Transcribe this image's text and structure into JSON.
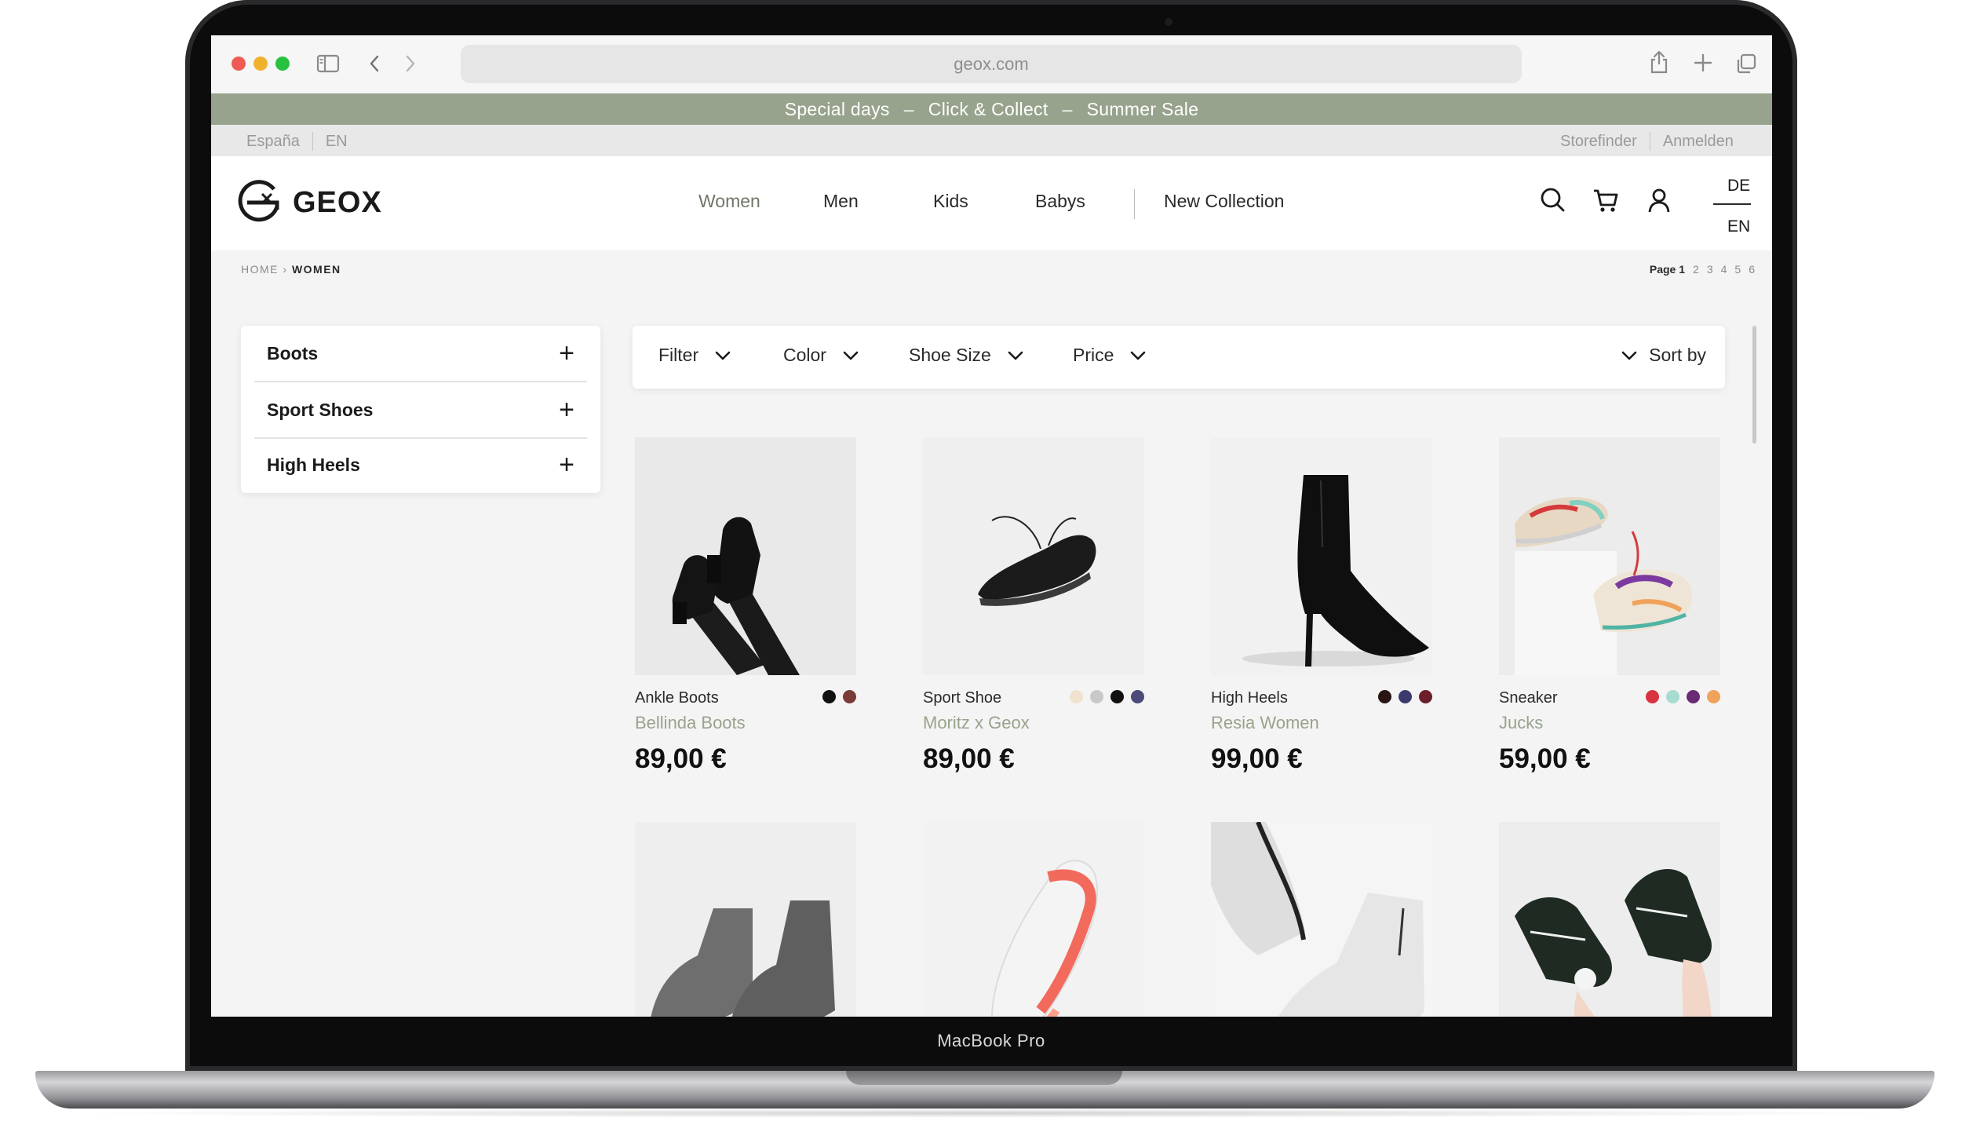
{
  "device": {
    "label": "MacBook Pro"
  },
  "browser": {
    "url": "geox.com"
  },
  "promo": {
    "item1": "Special days",
    "item2": "Click & Collect",
    "item3": "Summer Sale",
    "separator": "–"
  },
  "utility": {
    "region": "España",
    "language": "EN",
    "storefinder": "Storefinder",
    "login": "Anmelden"
  },
  "header": {
    "brand": "GEOX",
    "nav": [
      "Women",
      "Men",
      "Kids",
      "Babys",
      "New Collection"
    ],
    "active_nav": "Women",
    "lang_top": "DE",
    "lang_bottom": "EN"
  },
  "breadcrumb": {
    "home": "HOME",
    "separator": "›",
    "current": "WOMEN"
  },
  "pagination": {
    "label": "Page 1",
    "pages": [
      "2",
      "3",
      "4",
      "5",
      "6"
    ]
  },
  "sidebar": {
    "items": [
      "Boots",
      "Sport Shoes",
      "High Heels"
    ]
  },
  "filters": {
    "items": [
      "Filter",
      "Color",
      "Shoe Size",
      "Price"
    ],
    "sort": "Sort by"
  },
  "products": [
    {
      "category": "Ankle Boots",
      "name": "Bellinda Boots",
      "price": "89,00 €",
      "colors": [
        "#111111",
        "#7a3a36"
      ]
    },
    {
      "category": "Sport Shoe",
      "name": "Moritz x Geox",
      "price": "89,00 €",
      "colors": [
        "#efe2cf",
        "#c9c9c9",
        "#111111",
        "#4b4a78"
      ]
    },
    {
      "category": "High Heels",
      "name": "Resia Women",
      "price": "99,00 €",
      "colors": [
        "#2a1414",
        "#3a3a6e",
        "#6b1f2a"
      ]
    },
    {
      "category": "Sneaker",
      "name": "Jucks",
      "price": "59,00 €",
      "colors": [
        "#d8343f",
        "#a9dcd0",
        "#6a2b74",
        "#f0a25a"
      ]
    }
  ]
}
